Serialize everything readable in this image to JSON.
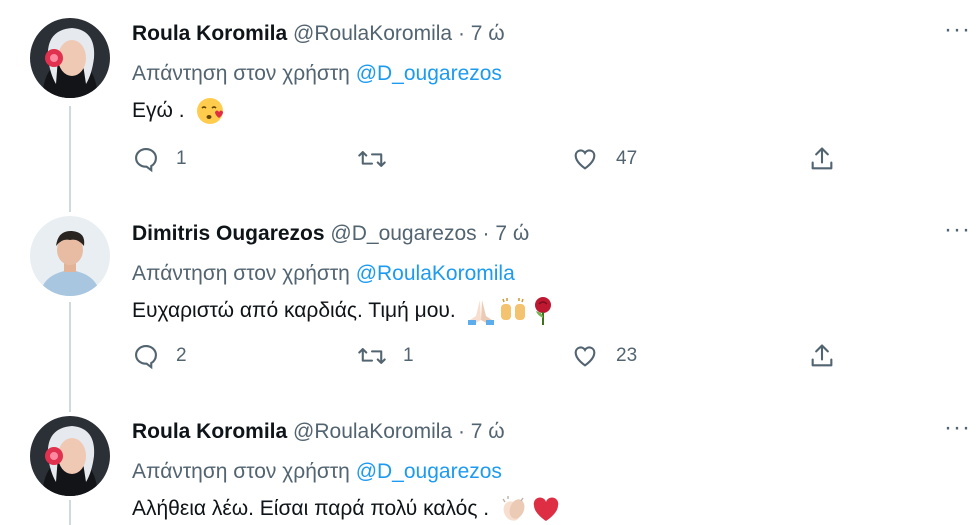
{
  "tweets": [
    {
      "name": "Roula Koromila",
      "handle": "@RoulaKoromila",
      "sep": "·",
      "time": "7 ώ",
      "reply_prefix": "Απάντηση στον χρήστη",
      "reply_mention": "@D_ougarezos",
      "text": "Εγώ .",
      "emojis": [
        "kissing-face-emoji"
      ],
      "replies": "1",
      "retweets": "",
      "likes": "47",
      "more": "···"
    },
    {
      "name": "Dimitris Ougarezos",
      "handle": "@D_ougarezos",
      "sep": "·",
      "time": "7 ώ",
      "reply_prefix": "Απάντηση στον χρήστη",
      "reply_mention": "@RoulaKoromila",
      "text": "Ευχαριστώ από καρδιάς. Τιμή μου.",
      "emojis": [
        "folded-hands-emoji",
        "raised-hands-emoji",
        "rose-emoji"
      ],
      "replies": "2",
      "retweets": "1",
      "likes": "23",
      "more": "···"
    },
    {
      "name": "Roula Koromila",
      "handle": "@RoulaKoromila",
      "sep": "·",
      "time": "7 ώ",
      "reply_prefix": "Απάντηση στον χρήστη",
      "reply_mention": "@D_ougarezos",
      "text": "Αλήθεια λέω. Είσαι παρά πολύ καλός .",
      "emojis": [
        "clapping-hands-emoji",
        "red-heart-emoji"
      ],
      "replies": "",
      "retweets": "",
      "likes": "",
      "more": "···"
    }
  ],
  "colors": {
    "text": "#0f1419",
    "secondary": "#536471",
    "link": "#1d9bf0",
    "thread_line": "#cfd9de"
  }
}
